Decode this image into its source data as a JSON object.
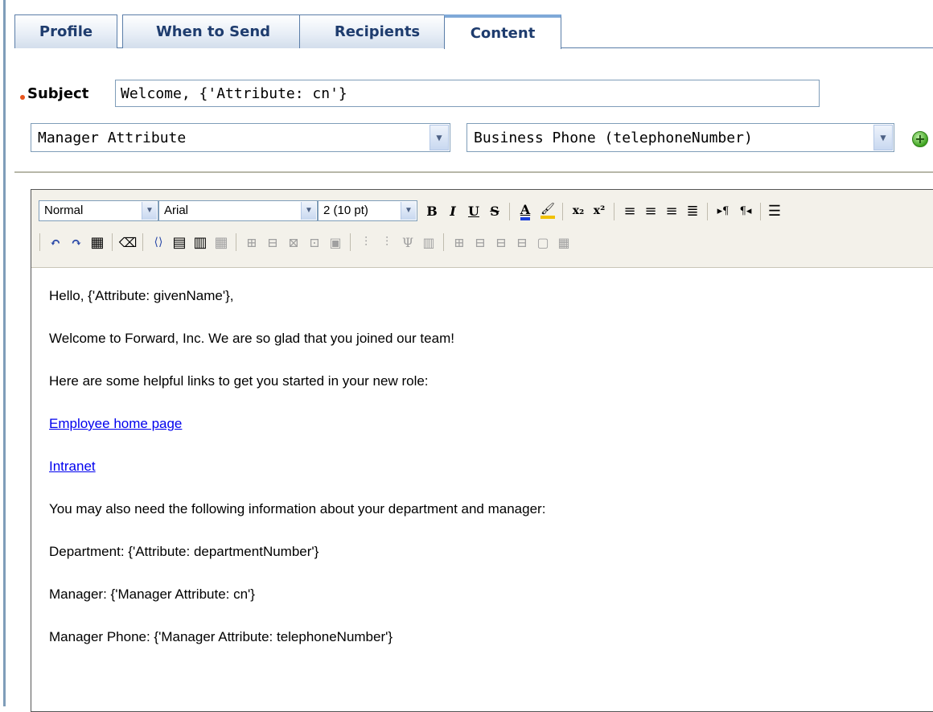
{
  "tabs": [
    {
      "label": "Profile",
      "active": false
    },
    {
      "label": "When to Send",
      "active": false
    },
    {
      "label": "Recipients",
      "active": false
    },
    {
      "label": "Content",
      "active": true
    }
  ],
  "subject": {
    "label": "Subject",
    "value": "Welcome, {'Attribute: cn'}",
    "required": true
  },
  "attribute_picker": {
    "source_select": "Manager Attribute",
    "attribute_select": "Business Phone (telephoneNumber)",
    "add_icon": "plus-circle-icon"
  },
  "editor": {
    "toolbar": {
      "format": "Normal",
      "font": "Arial",
      "size": "2 (10 pt)",
      "row1_icons": [
        "bold-icon",
        "italic-icon",
        "underline-icon",
        "strikethrough-icon",
        "font-color-icon",
        "highlight-color-icon",
        "subscript-icon",
        "superscript-icon",
        "align-left-icon",
        "align-center-icon",
        "align-right-icon",
        "justify-icon",
        "ltr-icon",
        "rtl-icon",
        "ordered-list-icon"
      ],
      "row2_icons": [
        "undo-icon",
        "redo-icon",
        "select-all-icon",
        "eraser-icon",
        "source-code-icon",
        "table-icon",
        "table-properties-icon",
        "table-delete-icon"
      ]
    },
    "body": {
      "greeting": "Hello, {'Attribute: givenName'},",
      "welcome": "Welcome to Forward, Inc. We are so glad that you joined our team!",
      "links_intro": "Here are some helpful links to get you started in your new role:",
      "link1": "Employee home page",
      "link2": "Intranet",
      "info_intro": "You may also need the following information about your department and manager:",
      "department": "Department: {'Attribute: departmentNumber'}",
      "manager": "Manager: {'Manager Attribute: cn'}",
      "manager_phone": "Manager Phone: {'Manager Attribute: telephoneNumber'}"
    }
  },
  "colors": {
    "accent": "#1e3c6e",
    "tab_border": "#5a7da8",
    "required": "#e8541c",
    "link": "#0000ee"
  }
}
